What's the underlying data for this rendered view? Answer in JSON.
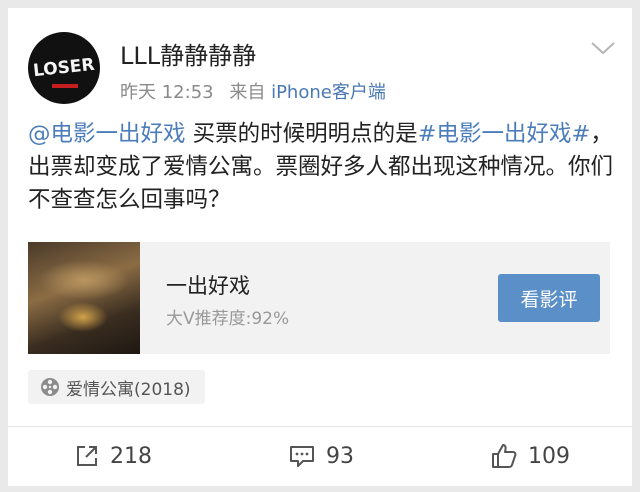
{
  "post": {
    "username": "LLL静静静静",
    "time": "昨天 12:53",
    "source_prefix": "来自",
    "source": "iPhone客户端",
    "body": {
      "mention": "@电影一出好戏",
      "text1": " 买票的时候明明点的是",
      "hashtag": "#电影一出好戏#",
      "text2": "，出票却变成了爱情公寓。票圈好多人都出现这种情况。你们不查查怎么回事吗？"
    },
    "avatar_text": "LOSER"
  },
  "movie_card": {
    "title": "一出好戏",
    "recommend": "大V推荐度:92%",
    "review_button": "看影评"
  },
  "tag": {
    "label": "爱情公寓(2018)",
    "icon": "film-reel-icon"
  },
  "actions": {
    "repost_count": "218",
    "comment_count": "93",
    "like_count": "109"
  },
  "colors": {
    "link": "#4c7dbb",
    "button": "#5b8fc7",
    "meta": "#8a8a8a"
  }
}
